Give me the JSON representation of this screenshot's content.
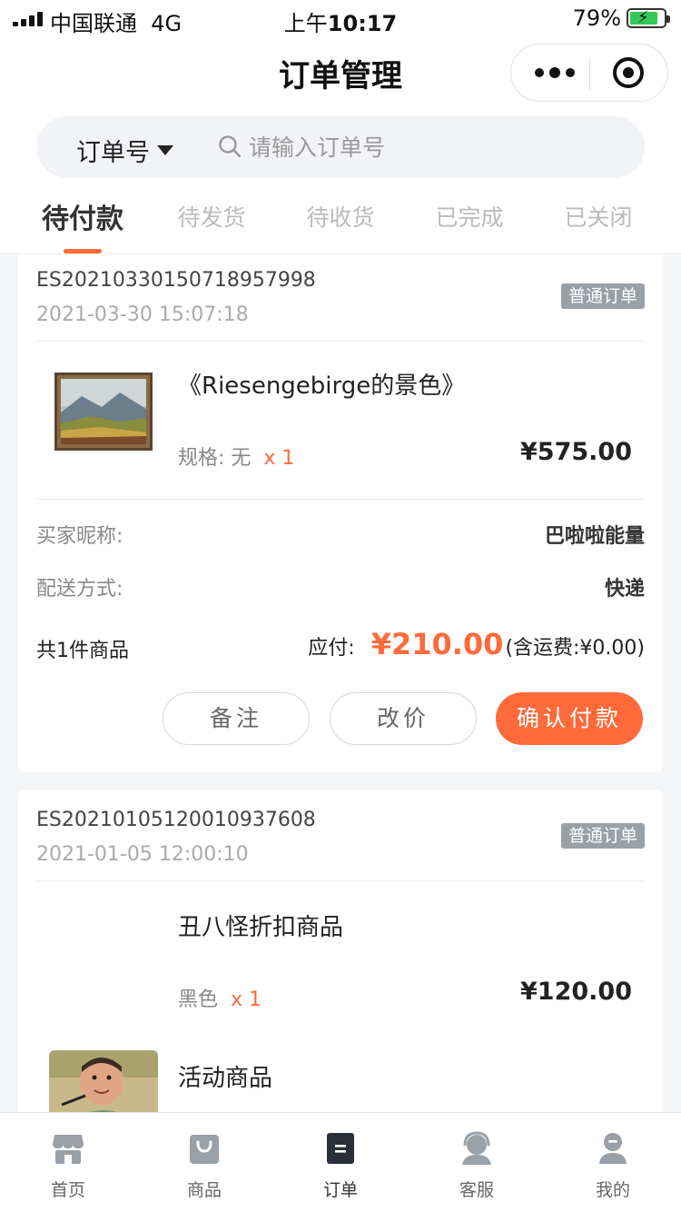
{
  "status_bar": {
    "carrier": "中国联通",
    "network": "4G",
    "time_prefix": "上午",
    "time": "10:17",
    "battery": "79%"
  },
  "nav": {
    "title": "订单管理"
  },
  "search": {
    "type_label": "订单号",
    "placeholder": "请输入订单号"
  },
  "tabs": [
    {
      "label": "待付款",
      "active": true
    },
    {
      "label": "待发货",
      "active": false
    },
    {
      "label": "待收货",
      "active": false
    },
    {
      "label": "已完成",
      "active": false
    },
    {
      "label": "已关闭",
      "active": false
    }
  ],
  "orders": [
    {
      "order_no": "ES202103301507189579​98",
      "date": "2021-03-30 15:07:18",
      "badge": "普通订单",
      "items": [
        {
          "name": "《Riesengebirge的景色》",
          "spec": "规格: 无",
          "qty": "x 1",
          "price": "¥575.00"
        }
      ],
      "buyer_label": "买家昵称:",
      "buyer_value": "巴啦啦能量",
      "delivery_label": "配送方式:",
      "delivery_value": "快递",
      "total_count": "共1件商品",
      "payable_label": "应付:",
      "payable_amount": "¥210.00",
      "shipping_note": "(含运费:¥0.00)",
      "buttons": {
        "remark": "备注",
        "change_price": "改价",
        "confirm_pay": "确认付款"
      }
    },
    {
      "order_no": "ES20210105120010937608",
      "date": "2021-01-05 12:00:10",
      "badge": "普通订单",
      "items": [
        {
          "name": "丑八怪折扣商品",
          "spec": "黑色",
          "qty": "x 1",
          "price": "¥120.00"
        },
        {
          "name": "活动商品"
        }
      ]
    }
  ],
  "tabbar": [
    {
      "label": "首页",
      "icon": "store-icon"
    },
    {
      "label": "商品",
      "icon": "bag-icon"
    },
    {
      "label": "订单",
      "icon": "order-icon",
      "active": true
    },
    {
      "label": "客服",
      "icon": "headset-icon"
    },
    {
      "label": "我的",
      "icon": "user-icon"
    }
  ],
  "colors": {
    "accent": "#ff6a3a",
    "badge": "#9aa0a8",
    "battery": "#35c759"
  }
}
